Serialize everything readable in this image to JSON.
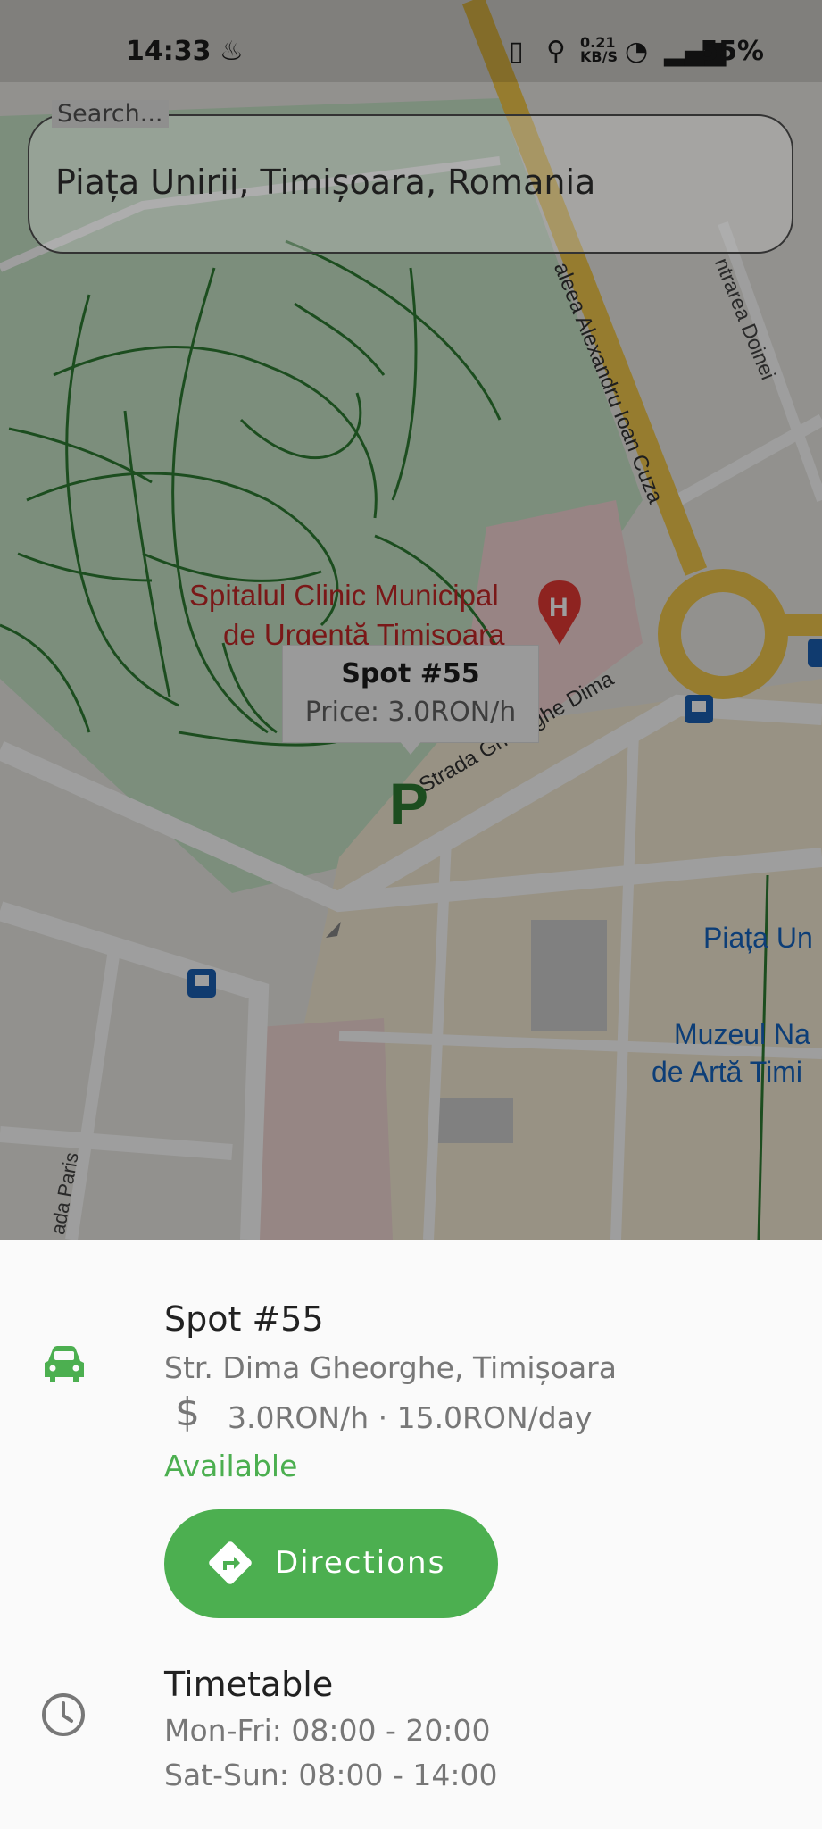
{
  "status_bar": {
    "time": "14:33",
    "network_speed": "0.21",
    "network_unit": "KB/S",
    "battery": "55%"
  },
  "search": {
    "label": "Search...",
    "value": "Piața Unirii, Timișoara, Romania"
  },
  "map": {
    "labels": {
      "hospital_line1": "Spitalul Clinic Municipal",
      "hospital_line2": "de Urgență Timișoara",
      "street_dima": "Strada Gheorghe Dima",
      "street_cuza": "aleea Alexandru Ioan Cuza",
      "street_doinei": "ntrarea Doinei",
      "square": "Piața Un",
      "museum_line1": "Muzeul Na",
      "museum_line2": "de Artă Timi",
      "street_paris": "ada Paris"
    },
    "marker_letter": "P",
    "info_window": {
      "title": "Spot #55",
      "price": "Price: 3.0RON/h"
    }
  },
  "spot": {
    "title": "Spot #55",
    "address": "Str. Dima Gheorghe, Timișoara",
    "currency_symbol": "$",
    "prices": "3.0RON/h · 15.0RON/day",
    "status": "Available",
    "directions_label": "Directions"
  },
  "timetable": {
    "title": "Timetable",
    "weekdays": "Mon-Fri: 08:00 - 20:00",
    "weekend": "Sat-Sun: 08:00 - 14:00"
  },
  "colors": {
    "accent_green": "#4caf50",
    "park_green": "#2e7d32",
    "road_yellow": "#f2c94c",
    "hospital_red": "#e53935",
    "poi_blue": "#1a5fb4"
  },
  "icons": {
    "car": "car-icon",
    "clock": "clock-icon",
    "directions": "directions-icon",
    "parking": "parking-marker-icon",
    "hospital": "hospital-pin-icon",
    "bus": "bus-stop-icon"
  }
}
